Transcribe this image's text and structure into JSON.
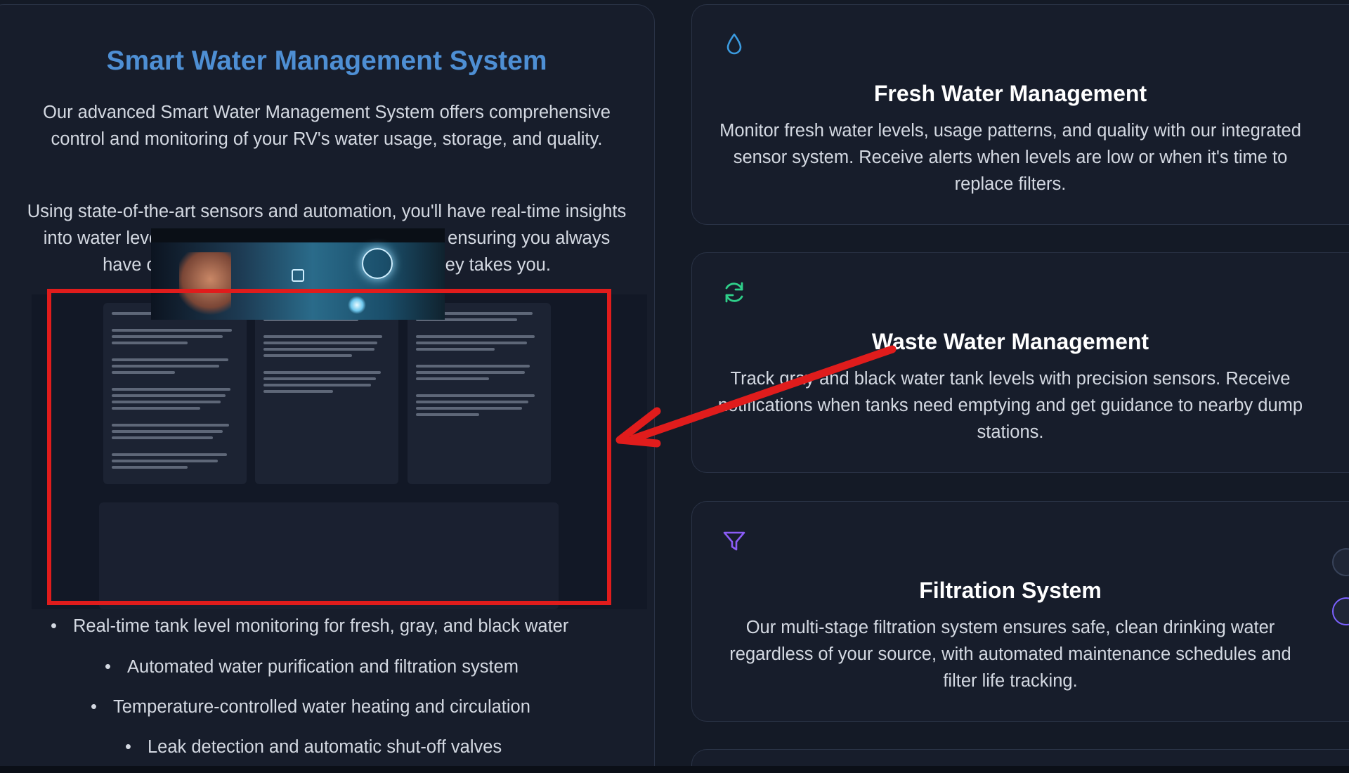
{
  "left": {
    "title": "Smart Water Management System",
    "intro_1": "Our advanced Smart Water Management System offers comprehensive control and monitoring of your RV's water usage, storage, and quality.",
    "intro_2": "Using state-of-the-art sensors and automation, you'll have real-time insights into water levels, temperature, and quality metrics, ensuring you always have clean, safe water wherever your journey takes you.",
    "bullets": [
      "Real-time tank level monitoring for fresh, gray, and black water",
      "Automated water purification and filtration system",
      "Temperature-controlled water heating and circulation",
      "Leak detection and automatic shut-off valves"
    ]
  },
  "cards": [
    {
      "icon": "droplet-icon",
      "color": "#3b9be0",
      "title": "Fresh Water Management",
      "body": "Monitor fresh water levels, usage patterns, and quality with our integrated sensor system. Receive alerts when levels are low or when it's time to replace filters."
    },
    {
      "icon": "refresh-icon",
      "color": "#2fd08a",
      "title": "Waste Water Management",
      "body": "Track gray and black water tank levels with precision sensors. Receive notifications when tanks need emptying and get guidance to nearby dump stations."
    },
    {
      "icon": "filter-icon",
      "color": "#8b5cf6",
      "title": "Filtration System",
      "body": "Our multi-stage filtration system ensures safe, clean drinking water regardless of your source, with automated maintenance schedules and filter life tracking."
    }
  ],
  "annotation": {
    "color": "#e01c1c"
  }
}
